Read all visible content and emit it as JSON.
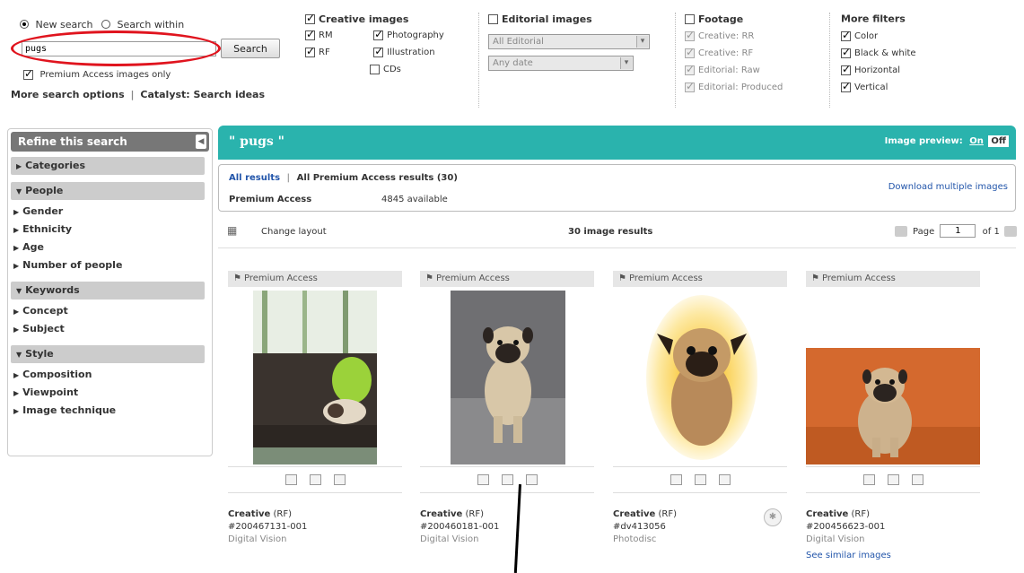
{
  "search": {
    "mode_new": "New search",
    "mode_within": "Search within",
    "query": "pugs",
    "button": "Search",
    "premium_only": "Premium Access images only",
    "more_options": "More search options",
    "separator": "|",
    "catalyst": "Catalyst: Search ideas"
  },
  "filters": {
    "creative_heading": "Creative images",
    "rm": "RM",
    "rf": "RF",
    "photography": "Photography",
    "illustration": "Illustration",
    "cds": "CDs",
    "editorial_heading": "Editorial images",
    "editorial_select": "All Editorial",
    "date_select": "Any date",
    "footage_heading": "Footage",
    "footage_items": [
      "Creative: RR",
      "Creative: RF",
      "Editorial: Raw",
      "Editorial: Produced"
    ],
    "more_heading": "More filters",
    "more_items": [
      "Color",
      "Black & white",
      "Horizontal",
      "Vertical"
    ]
  },
  "sidebar": {
    "title": "Refine this search",
    "categories": "Categories",
    "people": "People",
    "people_items": [
      "Gender",
      "Ethnicity",
      "Age",
      "Number of people"
    ],
    "keywords": "Keywords",
    "keywords_items": [
      "Concept",
      "Subject"
    ],
    "style": "Style",
    "style_items": [
      "Composition",
      "Viewpoint",
      "Image technique"
    ]
  },
  "results": {
    "banner_title": "\" pugs \"",
    "preview_label": "Image preview:",
    "preview_on": "On",
    "preview_off": "Off",
    "tab_all": "All results",
    "tab_premium": "All Premium Access results (30)",
    "premium_label": "Premium Access",
    "available": "4845 available",
    "download_multiple": "Download multiple images",
    "change_layout": "Change layout",
    "count": "30 image results",
    "page_label": "Page",
    "page_value": "1",
    "page_of": "of 1"
  },
  "tiles": [
    {
      "badge": "Premium Access",
      "type": "Creative",
      "license": "(RF)",
      "id": "#200467131-001",
      "source": "Digital Vision",
      "extra": ""
    },
    {
      "badge": "Premium Access",
      "type": "Creative",
      "license": "(RF)",
      "id": "#200460181-001",
      "source": "Digital Vision",
      "extra": ""
    },
    {
      "badge": "Premium Access",
      "type": "Creative",
      "license": "(RF)",
      "id": "#dv413056",
      "source": "Photodisc",
      "extra": ""
    },
    {
      "badge": "Premium Access",
      "type": "Creative",
      "license": "(RF)",
      "id": "#200456623-001",
      "source": "Digital Vision",
      "extra": "See similar images"
    }
  ],
  "colors": {
    "banner": "#2ab3ad",
    "link": "#2255aa",
    "annotation_red": "#e0141e"
  }
}
